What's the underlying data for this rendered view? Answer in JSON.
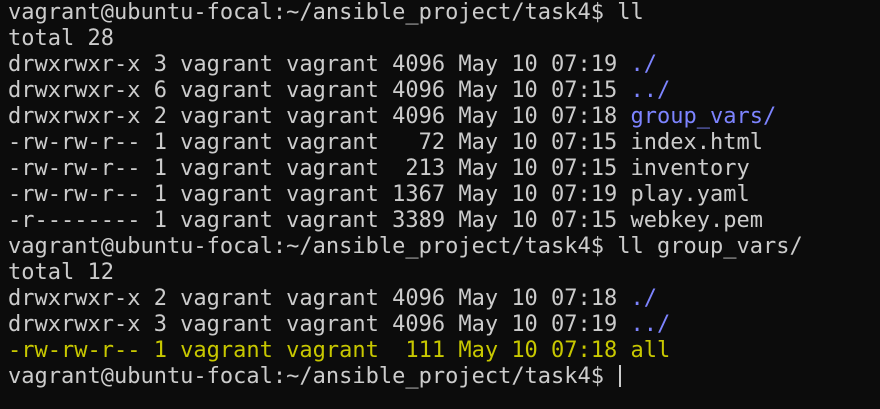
{
  "terminal": {
    "prompt1": "vagrant@ubuntu-focal:~/ansible_project/task4$ ll",
    "total1": "total 28",
    "list1": [
      {
        "meta": "drwxrwxr-x 3 vagrant vagrant 4096 May 10 07:19 ",
        "name": "./",
        "suffix": ""
      },
      {
        "meta": "drwxrwxr-x 6 vagrant vagrant 4096 May 10 07:15 ",
        "name": "../",
        "suffix": ""
      },
      {
        "meta": "drwxrwxr-x 2 vagrant vagrant 4096 May 10 07:18 ",
        "name": "group_vars",
        "suffix": "/"
      },
      {
        "meta": "-rw-rw-r-- 1 vagrant vagrant   72 May 10 07:15 ",
        "name": "index.html",
        "suffix": ""
      },
      {
        "meta": "-rw-rw-r-- 1 vagrant vagrant  213 May 10 07:15 ",
        "name": "inventory",
        "suffix": ""
      },
      {
        "meta": "-rw-rw-r-- 1 vagrant vagrant 1367 May 10 07:19 ",
        "name": "play.yaml",
        "suffix": ""
      },
      {
        "meta": "-r-------- 1 vagrant vagrant 3389 May 10 07:15 ",
        "name": "webkey.pem",
        "suffix": ""
      }
    ],
    "prompt2": "vagrant@ubuntu-focal:~/ansible_project/task4$ ll group_vars/",
    "total2": "total 12",
    "list2": [
      {
        "meta": "drwxrwxr-x 2 vagrant vagrant 4096 May 10 07:18 ",
        "name": "./"
      },
      {
        "meta": "drwxrwxr-x 3 vagrant vagrant 4096 May 10 07:19 ",
        "name": "../"
      },
      {
        "full": "-rw-rw-r-- 1 vagrant vagrant  111 May 10 07:18 all"
      }
    ],
    "prompt3": "vagrant@ubuntu-focal:~/ansible_project/task4$ ",
    "colors": {
      "background": "#0c0c0c",
      "text": "#cccccc",
      "directory": "#7d84ff",
      "highlight": "#c8c800"
    }
  }
}
